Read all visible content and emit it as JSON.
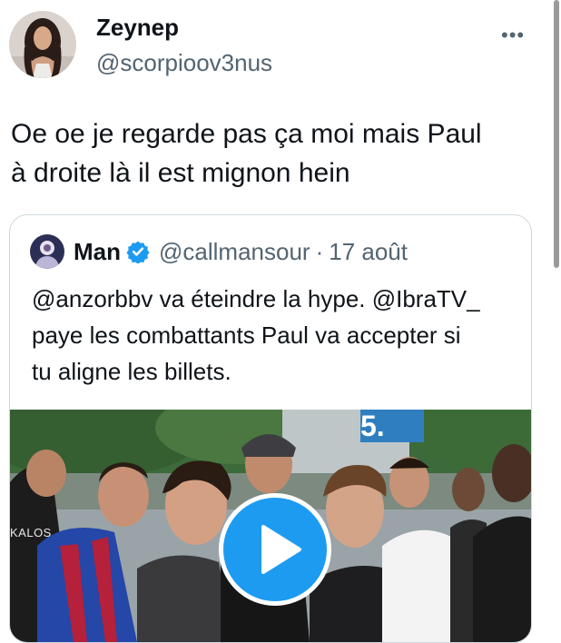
{
  "tweet": {
    "author_name": "Zeynep",
    "author_handle": "@scorpioov3nus",
    "more_label": "•••",
    "text_lines": [
      "Oe oe je regarde pas ça moi mais Paul",
      "à droite là il est mignon hein"
    ]
  },
  "quoted": {
    "author_name": "Man",
    "author_handle": "@callmansour",
    "separator": "·",
    "date": "17 août",
    "text_lines": [
      "@anzorbbv va éteindre la hype. @IbraTV_",
      "paye les combattants Paul va accepter si",
      "tu aligne les billets."
    ]
  },
  "media": {
    "kind": "video",
    "shirt_text": "KALOS",
    "sign_text": "5."
  },
  "colors": {
    "text": "#0f1419",
    "secondary": "#536471",
    "accent": "#1d9bf0",
    "border": "#cfd9de"
  },
  "icons": [
    "more-icon",
    "verified-badge-icon",
    "play-icon"
  ]
}
